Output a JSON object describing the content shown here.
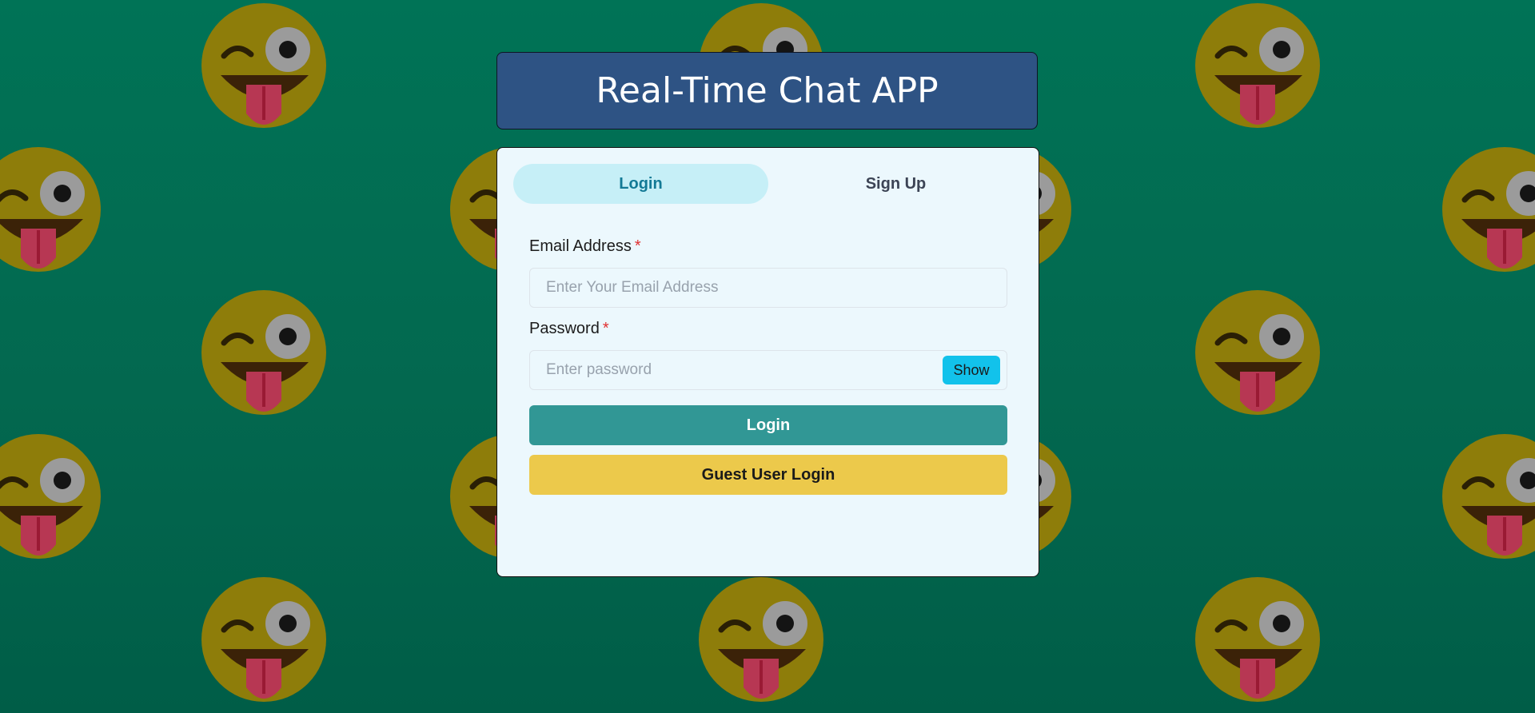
{
  "header": {
    "title": "Real-Time Chat APP"
  },
  "tabs": [
    {
      "label": "Login",
      "active": true
    },
    {
      "label": "Sign Up",
      "active": false
    }
  ],
  "form": {
    "email_label": "Email Address",
    "email_placeholder": "Enter Your Email Address",
    "email_value": "",
    "password_label": "Password",
    "password_placeholder": "Enter password",
    "password_value": "",
    "required_mark": "*",
    "show_label": "Show",
    "login_label": "Login",
    "guest_label": "Guest User Login"
  },
  "background": {
    "pattern_icon": "winking-tongue-emoji-icon"
  },
  "colors": {
    "background": "#007356",
    "header": "#2e5384",
    "card": "#ecf8fd",
    "active_tab": "#c6eff7",
    "login_button": "#319795",
    "guest_button": "#ecc94b",
    "show_button": "#12c2eb",
    "required": "#e03131"
  }
}
